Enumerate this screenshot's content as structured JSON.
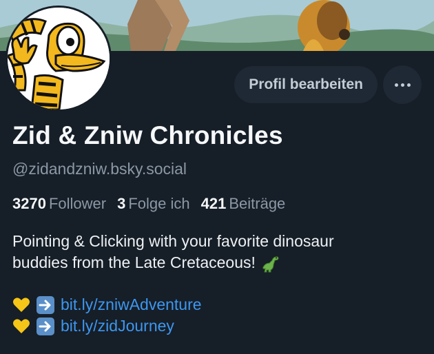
{
  "profile": {
    "display_name": "Zid & Zniw Chronicles",
    "handle": "@zidandzniw.bsky.social",
    "edit_button_label": "Profil bearbeiten",
    "more_button_label": "•••"
  },
  "stats": [
    {
      "value": "3270",
      "label": "Follower"
    },
    {
      "value": "3",
      "label": "Folge ich"
    },
    {
      "value": "421",
      "label": "Beiträge"
    }
  ],
  "bio": {
    "line1": "Pointing & Clicking with your favorite dinosaur",
    "line2": "buddies from the Late Cretaceous!",
    "line2_emoji": "dinosaur-icon",
    "links": [
      {
        "emoji": "yellow-heart-icon",
        "arrow": "right-arrow-icon",
        "text": "bit.ly/zniwAdventure"
      },
      {
        "emoji": "yellow-heart-icon",
        "arrow": "right-arrow-icon",
        "text": "bit.ly/zidJourney"
      }
    ]
  },
  "colors": {
    "background": "#161e27",
    "button_bg": "#1e2935",
    "muted_text": "#8b98a6",
    "link": "#3d97f0",
    "heart": "#f5c518"
  }
}
